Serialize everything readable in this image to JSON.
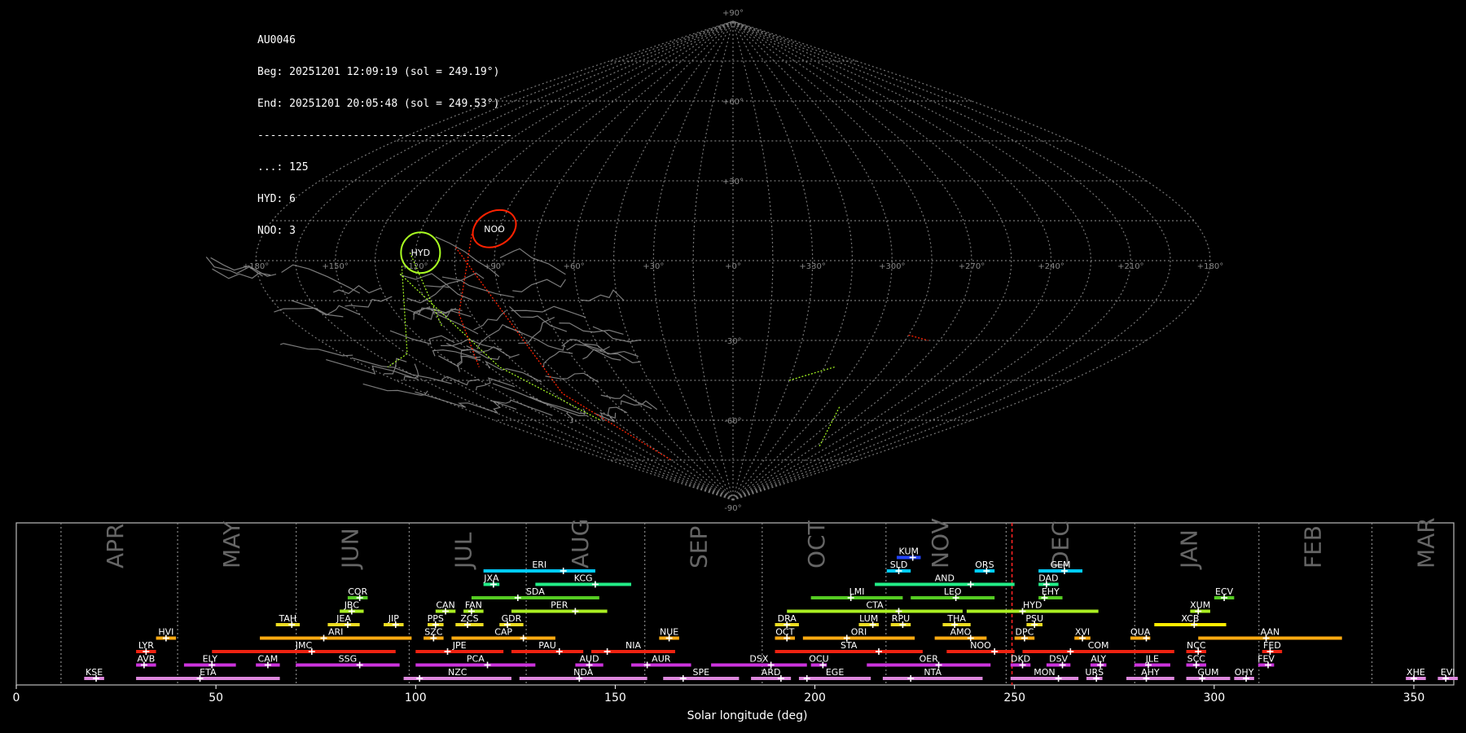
{
  "info": {
    "code": "AU0046",
    "beg": "Beg: 20251201 12:09:19 (sol = 249.19°)",
    "end": "End: 20251201 20:05:48 (sol = 249.53°)",
    "sep": "----------------------------------------",
    "counts": [
      "...: 125",
      "HYD: 6",
      "NOO: 3"
    ]
  },
  "sky_map": {
    "lat_labels": [
      "+90°",
      "+60°",
      "+30°",
      "-30°",
      "-60°",
      "-90°"
    ],
    "lon_labels": [
      "+180°",
      "+150°",
      "+120°",
      "+90°",
      "+60°",
      "+30°",
      "+0°",
      "+330°",
      "+300°",
      "+270°",
      "+240°",
      "+210°",
      "+180°"
    ],
    "radiants": [
      {
        "code": "HYD",
        "color": "#aaff22"
      },
      {
        "code": "NOO",
        "color": "#ff2200"
      }
    ]
  },
  "chart_data": {
    "type": "gantt",
    "xlabel": "Solar longitude (deg)",
    "xlim": [
      0,
      360
    ],
    "xticks": [
      "0",
      "50",
      "100",
      "150",
      "200",
      "250",
      "300",
      "350"
    ],
    "marker_sol": 249.36,
    "months": [
      {
        "name": "APR",
        "start": 11.2
      },
      {
        "name": "MAY",
        "start": 40.4
      },
      {
        "name": "JUN",
        "start": 70.1
      },
      {
        "name": "JUL",
        "start": 98.4
      },
      {
        "name": "AUG",
        "start": 127.7
      },
      {
        "name": "SEP",
        "start": 157.4
      },
      {
        "name": "OCT",
        "start": 186.8
      },
      {
        "name": "NOV",
        "start": 217.8
      },
      {
        "name": "DEC",
        "start": 247.9
      },
      {
        "name": "JAN",
        "start": 280.1
      },
      {
        "name": "FEB",
        "start": 311.2
      },
      {
        "name": "MAR",
        "start": 339.5
      }
    ],
    "showers": [
      {
        "code": "KUM",
        "start": 220.5,
        "end": 226.5,
        "peak": 224.5,
        "row": 9,
        "color": "#2244ff"
      },
      {
        "code": "ERI",
        "start": 117,
        "end": 145,
        "peak": 137,
        "row": 8,
        "color": "#00ccff"
      },
      {
        "code": "SLD",
        "start": 218,
        "end": 224,
        "peak": 221,
        "row": 8,
        "color": "#00ccff"
      },
      {
        "code": "ORS",
        "start": 240,
        "end": 245,
        "peak": 243,
        "row": 8,
        "color": "#00ccff"
      },
      {
        "code": "GEM",
        "start": 256,
        "end": 267,
        "peak": 262.5,
        "row": 8,
        "color": "#00ccff"
      },
      {
        "code": "JXA",
        "start": 117,
        "end": 121,
        "peak": 119.5,
        "row": 7,
        "color": "#22ee88"
      },
      {
        "code": "KCG",
        "start": 130,
        "end": 154,
        "peak": 145,
        "row": 7,
        "color": "#22ee88"
      },
      {
        "code": "AND",
        "start": 215,
        "end": 250,
        "peak": 239,
        "row": 7,
        "color": "#22ee88"
      },
      {
        "code": "DAD",
        "start": 256,
        "end": 261,
        "peak": 258,
        "row": 7,
        "color": "#22ee88"
      },
      {
        "code": "COR",
        "start": 83,
        "end": 88,
        "peak": 86,
        "row": 6,
        "color": "#55cc22"
      },
      {
        "code": "SDA",
        "start": 114,
        "end": 146,
        "peak": 125.6,
        "row": 6,
        "color": "#55cc22"
      },
      {
        "code": "LMI",
        "start": 199,
        "end": 222,
        "peak": 209,
        "row": 6,
        "color": "#55cc22"
      },
      {
        "code": "LEO",
        "start": 224,
        "end": 245,
        "peak": 235.3,
        "row": 6,
        "color": "#55cc22"
      },
      {
        "code": "EHY",
        "start": 256,
        "end": 262,
        "peak": 257.5,
        "row": 6,
        "color": "#55cc22"
      },
      {
        "code": "ECV",
        "start": 300,
        "end": 305,
        "peak": 302.5,
        "row": 6,
        "color": "#55cc22"
      },
      {
        "code": "JBC",
        "start": 81,
        "end": 87,
        "peak": 84,
        "row": 5,
        "color": "#aaee22"
      },
      {
        "code": "CAN",
        "start": 105,
        "end": 110,
        "peak": 107.5,
        "row": 5,
        "color": "#aaee22"
      },
      {
        "code": "FAN",
        "start": 112,
        "end": 117,
        "peak": 114,
        "row": 5,
        "color": "#aaee22"
      },
      {
        "code": "PER",
        "start": 124,
        "end": 148,
        "peak": 140,
        "row": 5,
        "color": "#aaee22"
      },
      {
        "code": "CTA",
        "start": 193,
        "end": 237,
        "peak": 221,
        "row": 5,
        "color": "#aaee22"
      },
      {
        "code": "HYD",
        "start": 238,
        "end": 271,
        "peak": 252,
        "row": 5,
        "color": "#aaee22"
      },
      {
        "code": "XUM",
        "start": 294,
        "end": 299,
        "peak": 296,
        "row": 5,
        "color": "#aaee22"
      },
      {
        "code": "TAH",
        "start": 65,
        "end": 71,
        "peak": 69,
        "row": 4,
        "color": "#eedd22"
      },
      {
        "code": "JEA",
        "start": 78,
        "end": 86,
        "peak": 83,
        "row": 4,
        "color": "#eedd22"
      },
      {
        "code": "JIP",
        "start": 92,
        "end": 97,
        "peak": 95,
        "row": 4,
        "color": "#eedd22"
      },
      {
        "code": "PPS",
        "start": 103,
        "end": 107,
        "peak": 105,
        "row": 4,
        "color": "#eedd22"
      },
      {
        "code": "ZCS",
        "start": 110,
        "end": 117,
        "peak": 113,
        "row": 4,
        "color": "#eedd22"
      },
      {
        "code": "GDR",
        "start": 121,
        "end": 127,
        "peak": 123,
        "row": 4,
        "color": "#eedd22"
      },
      {
        "code": "DRA",
        "start": 190,
        "end": 196,
        "peak": 193,
        "row": 4,
        "color": "#eedd22"
      },
      {
        "code": "LUM",
        "start": 211,
        "end": 216,
        "peak": 214.5,
        "row": 4,
        "color": "#eedd22"
      },
      {
        "code": "RPU",
        "start": 219,
        "end": 224,
        "peak": 222,
        "row": 4,
        "color": "#eedd22"
      },
      {
        "code": "THA",
        "start": 232,
        "end": 239,
        "peak": 235,
        "row": 4,
        "color": "#eedd22"
      },
      {
        "code": "PSU",
        "start": 253,
        "end": 257,
        "peak": 255,
        "row": 4,
        "color": "#eedd22"
      },
      {
        "code": "XCB",
        "start": 285,
        "end": 303,
        "peak": 295,
        "row": 4,
        "color": "#ffee00"
      },
      {
        "code": "HVI",
        "start": 35,
        "end": 40,
        "peak": 37.5,
        "row": 3,
        "color": "#ffaa11"
      },
      {
        "code": "ARI",
        "start": 61,
        "end": 99,
        "peak": 77,
        "row": 3,
        "color": "#ffaa11"
      },
      {
        "code": "SZC",
        "start": 102,
        "end": 107,
        "peak": 104.5,
        "row": 3,
        "color": "#ffaa11"
      },
      {
        "code": "CAP",
        "start": 109,
        "end": 135,
        "peak": 127,
        "row": 3,
        "color": "#ffaa11"
      },
      {
        "code": "NUE",
        "start": 161,
        "end": 166,
        "peak": 163.5,
        "row": 3,
        "color": "#ffaa11"
      },
      {
        "code": "OCT",
        "start": 190,
        "end": 195,
        "peak": 193,
        "row": 3,
        "color": "#ffaa11"
      },
      {
        "code": "ORI",
        "start": 197,
        "end": 225,
        "peak": 208,
        "row": 3,
        "color": "#ffaa11"
      },
      {
        "code": "AMO",
        "start": 230,
        "end": 243,
        "peak": 239,
        "row": 3,
        "color": "#ffaa11"
      },
      {
        "code": "DPC",
        "start": 250,
        "end": 255,
        "peak": 252.5,
        "row": 3,
        "color": "#ffaa11"
      },
      {
        "code": "XVI",
        "start": 265,
        "end": 269,
        "peak": 267,
        "row": 3,
        "color": "#ffaa11"
      },
      {
        "code": "QUA",
        "start": 279,
        "end": 284,
        "peak": 283,
        "row": 3,
        "color": "#ffaa11"
      },
      {
        "code": "AAN",
        "start": 296,
        "end": 332,
        "peak": 313,
        "row": 3,
        "color": "#ffaa11"
      },
      {
        "code": "LYR",
        "start": 30,
        "end": 35,
        "peak": 32.5,
        "row": 2,
        "color": "#ee2211"
      },
      {
        "code": "JMC",
        "start": 49,
        "end": 95,
        "peak": 74,
        "row": 2,
        "color": "#ee2211"
      },
      {
        "code": "JPE",
        "start": 100,
        "end": 122,
        "peak": 108,
        "row": 2,
        "color": "#ee2211"
      },
      {
        "code": "PAU",
        "start": 124,
        "end": 142,
        "peak": 136,
        "row": 2,
        "color": "#ee2211"
      },
      {
        "code": "NIA",
        "start": 144,
        "end": 165,
        "peak": 148,
        "row": 2,
        "color": "#ee2211"
      },
      {
        "code": "STA",
        "start": 190,
        "end": 227,
        "peak": 216,
        "row": 2,
        "color": "#ee2211"
      },
      {
        "code": "NOO",
        "start": 233,
        "end": 250,
        "peak": 245,
        "row": 2,
        "color": "#ee2211"
      },
      {
        "code": "COM",
        "start": 252,
        "end": 290,
        "peak": 264,
        "row": 2,
        "color": "#ee2211"
      },
      {
        "code": "NCC",
        "start": 293,
        "end": 298,
        "peak": 296,
        "row": 2,
        "color": "#ee2211"
      },
      {
        "code": "FED",
        "start": 312,
        "end": 317,
        "peak": 314,
        "row": 2,
        "color": "#ee2211"
      },
      {
        "code": "AVB",
        "start": 30,
        "end": 35,
        "peak": 32,
        "row": 1,
        "color": "#cc33dd"
      },
      {
        "code": "ELY",
        "start": 42,
        "end": 55,
        "peak": 49,
        "row": 1,
        "color": "#cc33dd"
      },
      {
        "code": "CAM",
        "start": 60,
        "end": 66,
        "peak": 63,
        "row": 1,
        "color": "#cc33dd"
      },
      {
        "code": "SSG",
        "start": 70,
        "end": 96,
        "peak": 86,
        "row": 1,
        "color": "#cc33dd"
      },
      {
        "code": "PCA",
        "start": 100,
        "end": 130,
        "peak": 118,
        "row": 1,
        "color": "#cc33dd"
      },
      {
        "code": "AUD",
        "start": 140,
        "end": 147,
        "peak": 143.5,
        "row": 1,
        "color": "#cc33dd"
      },
      {
        "code": "AUR",
        "start": 154,
        "end": 169,
        "peak": 158,
        "row": 1,
        "color": "#cc33dd"
      },
      {
        "code": "DSX",
        "start": 174,
        "end": 198,
        "peak": 189,
        "row": 1,
        "color": "#cc33dd"
      },
      {
        "code": "OCU",
        "start": 199,
        "end": 203,
        "peak": 202,
        "row": 1,
        "color": "#cc33dd"
      },
      {
        "code": "OER",
        "start": 213,
        "end": 244,
        "peak": 231,
        "row": 1,
        "color": "#cc33dd"
      },
      {
        "code": "DKD",
        "start": 249,
        "end": 254,
        "peak": 252,
        "row": 1,
        "color": "#cc33dd"
      },
      {
        "code": "DSV",
        "start": 258,
        "end": 264,
        "peak": 262,
        "row": 1,
        "color": "#cc33dd"
      },
      {
        "code": "ALY",
        "start": 269,
        "end": 273,
        "peak": 271.5,
        "row": 1,
        "color": "#cc33dd"
      },
      {
        "code": "JLE",
        "start": 280,
        "end": 289,
        "peak": 283.5,
        "row": 1,
        "color": "#cc33dd"
      },
      {
        "code": "SCC",
        "start": 293,
        "end": 298,
        "peak": 295.5,
        "row": 1,
        "color": "#cc33dd"
      },
      {
        "code": "FEV",
        "start": 311,
        "end": 315,
        "peak": 313.5,
        "row": 1,
        "color": "#cc33dd"
      },
      {
        "code": "KSE",
        "start": 17,
        "end": 22,
        "peak": 20,
        "row": 0,
        "color": "#dd88dd"
      },
      {
        "code": "ETA",
        "start": 30,
        "end": 66,
        "peak": 46,
        "row": 0,
        "color": "#dd88dd"
      },
      {
        "code": "NZC",
        "start": 97,
        "end": 124,
        "peak": 101,
        "row": 0,
        "color": "#dd88dd"
      },
      {
        "code": "NDA",
        "start": 126,
        "end": 158,
        "peak": 141,
        "row": 0,
        "color": "#dd88dd"
      },
      {
        "code": "SPE",
        "start": 162,
        "end": 181,
        "peak": 167,
        "row": 0,
        "color": "#dd88dd"
      },
      {
        "code": "ARD",
        "start": 184,
        "end": 194,
        "peak": 191.5,
        "row": 0,
        "color": "#dd88dd"
      },
      {
        "code": "EGE",
        "start": 196,
        "end": 214,
        "peak": 198,
        "row": 0,
        "color": "#dd88dd"
      },
      {
        "code": "NTA",
        "start": 217,
        "end": 242,
        "peak": 224,
        "row": 0,
        "color": "#dd88dd"
      },
      {
        "code": "MON",
        "start": 249,
        "end": 266,
        "peak": 261,
        "row": 0,
        "color": "#dd88dd"
      },
      {
        "code": "URS",
        "start": 268,
        "end": 272,
        "peak": 270.5,
        "row": 0,
        "color": "#dd88dd"
      },
      {
        "code": "AHY",
        "start": 278,
        "end": 290,
        "peak": 283,
        "row": 0,
        "color": "#dd88dd"
      },
      {
        "code": "GUM",
        "start": 293,
        "end": 304,
        "peak": 297,
        "row": 0,
        "color": "#dd88dd"
      },
      {
        "code": "OHY",
        "start": 305,
        "end": 310,
        "peak": 308,
        "row": 0,
        "color": "#dd88dd"
      },
      {
        "code": "XHE",
        "start": 348,
        "end": 353,
        "peak": 350,
        "row": 0,
        "color": "#dd88dd"
      },
      {
        "code": "EVI",
        "start": 356,
        "end": 361,
        "peak": 358,
        "row": 0,
        "color": "#dd88dd"
      }
    ]
  }
}
